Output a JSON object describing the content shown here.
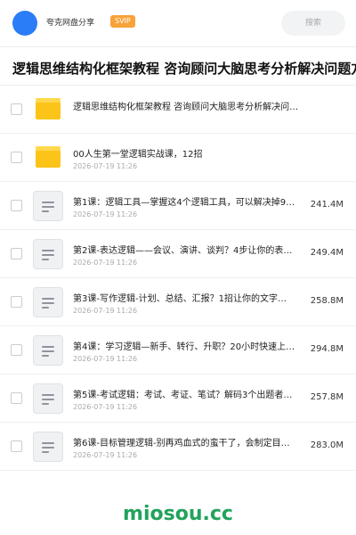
{
  "header": {
    "user_name": "夸克网盘分享",
    "badge": "SVIP",
    "search_placeholder": "搜索"
  },
  "page_title": "逻辑思维结构化框架教程 咨询顾问大脑思考分析解决问题方",
  "files": [
    {
      "type": "folder",
      "name": "逻辑思维结构化框架教程 咨询顾问大脑思考分析解决问…",
      "date": "",
      "size": ""
    },
    {
      "type": "folder",
      "name": "00人生第一堂逻辑实战课，12招",
      "date": "2026-07-19 11:26",
      "size": ""
    },
    {
      "type": "doc",
      "name": "第1课：逻辑工具—掌握这4个逻辑工具，可以解决掉9…",
      "date": "2026-07-19 11:26",
      "size": "241.4M"
    },
    {
      "type": "doc",
      "name": "第2课-表达逻辑——会议、演讲、谈判？4步让你的表…",
      "date": "2026-07-19 11:26",
      "size": "249.4M"
    },
    {
      "type": "doc",
      "name": "第3课-写作逻辑-计划、总结、汇报？1招让你的文字…",
      "date": "2026-07-19 11:26",
      "size": "258.8M"
    },
    {
      "type": "doc",
      "name": "第4课：学习逻辑—新手、转行、升职？20小时快速上…",
      "date": "2026-07-19 11:26",
      "size": "294.8M"
    },
    {
      "type": "doc",
      "name": "第5课-考试逻辑：考试、考证、笔试？解码3个出题者…",
      "date": "2026-07-19 11:26",
      "size": "257.8M"
    },
    {
      "type": "doc",
      "name": "第6课-目标管理逻辑-别再鸡血式的蛮干了，会制定目…",
      "date": "2026-07-19 11:26",
      "size": "283.0M"
    }
  ],
  "watermark": "miosou.cc",
  "colors": {
    "accent": "#2a7df6",
    "badge": "#f8a23a",
    "folder": "#fcc419",
    "watermark": "#21a35b"
  }
}
